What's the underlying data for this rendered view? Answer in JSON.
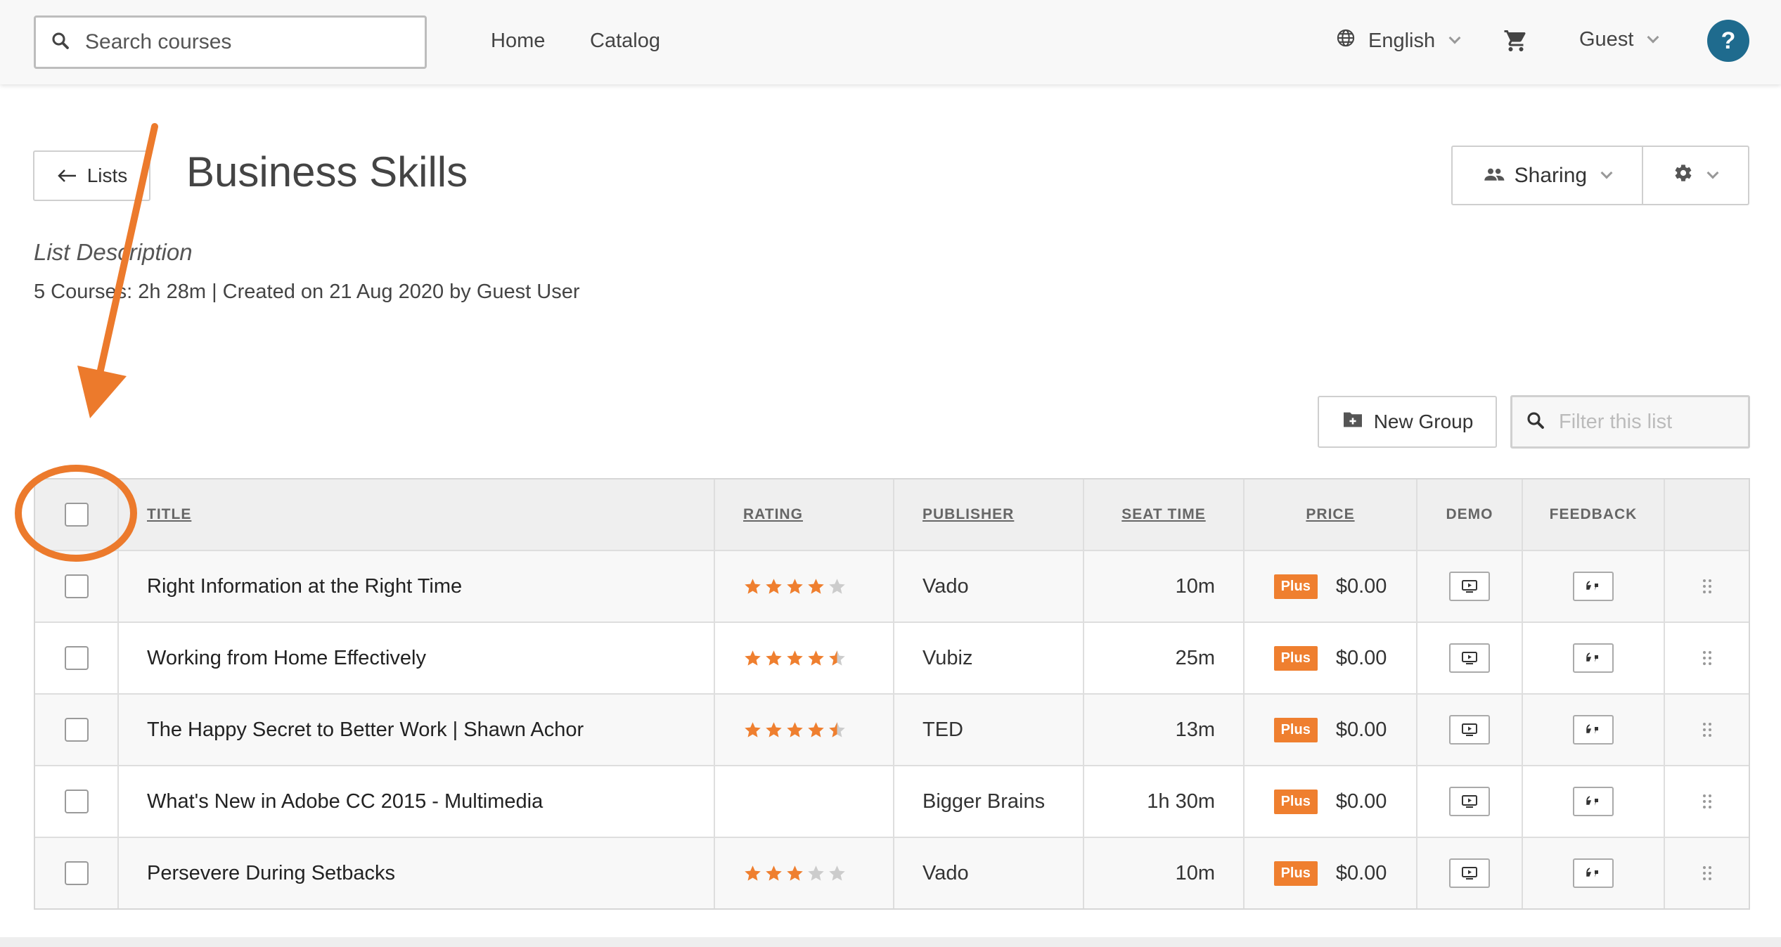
{
  "nav": {
    "search_placeholder": "Search courses",
    "home": "Home",
    "catalog": "Catalog",
    "language": "English",
    "user": "Guest",
    "help": "?"
  },
  "page": {
    "back_label": "Lists",
    "title": "Business Skills",
    "description": "List Description",
    "meta": "5 Courses: 2h 28m | Created on 21 Aug 2020 by Guest User",
    "sharing_label": "Sharing",
    "new_group_label": "New Group",
    "filter_placeholder": "Filter this list"
  },
  "table": {
    "headers": {
      "title": "TITLE",
      "rating": "RATING",
      "publisher": "PUBLISHER",
      "seat_time": "SEAT TIME",
      "price": "PRICE",
      "demo": "DEMO",
      "feedback": "FEEDBACK"
    },
    "rows": [
      {
        "title": "Right Information at the Right Time",
        "rating": 4,
        "publisher": "Vado",
        "seat_time": "10m",
        "badge": "Plus",
        "price": "$0.00"
      },
      {
        "title": "Working from Home Effectively",
        "rating": 4.5,
        "publisher": "Vubiz",
        "seat_time": "25m",
        "badge": "Plus",
        "price": "$0.00"
      },
      {
        "title": "The Happy Secret to Better Work | Shawn Achor",
        "rating": 4.5,
        "publisher": "TED",
        "seat_time": "13m",
        "badge": "Plus",
        "price": "$0.00"
      },
      {
        "title": "What's New in Adobe CC 2015 - Multimedia",
        "rating": null,
        "publisher": "Bigger Brains",
        "seat_time": "1h 30m",
        "badge": "Plus",
        "price": "$0.00"
      },
      {
        "title": "Persevere During Setbacks",
        "rating": 3,
        "publisher": "Vado",
        "seat_time": "10m",
        "badge": "Plus",
        "price": "$0.00"
      }
    ]
  },
  "colors": {
    "accent": "#ef7f2f",
    "help_button": "#1f6b8e",
    "star_empty": "#cccccc"
  },
  "icons": {
    "search": "search-icon",
    "globe": "globe-icon",
    "cart": "cart-icon",
    "back": "arrow-left-icon",
    "people": "people-icon",
    "gear": "gear-icon",
    "folder_plus": "folder-plus-icon",
    "demo": "play-screen-icon",
    "feedback": "quote-icon",
    "drag": "drag-handle-icon"
  }
}
